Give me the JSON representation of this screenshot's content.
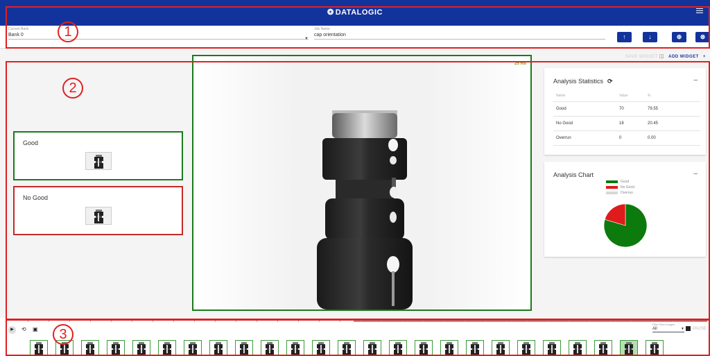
{
  "header": {
    "brand_mark": "❂",
    "brand": "DATALOGIC",
    "menu_icon": "hamburger-icon"
  },
  "job": {
    "bank_label": "Current Bank",
    "bank_value": "Bank 0",
    "job_label": "Job Name",
    "job_value": "cap orientation",
    "buttons": [
      {
        "name": "upload-button",
        "glyph": "↑"
      },
      {
        "name": "download-button",
        "glyph": "↓"
      },
      {
        "name": "add-circle-button",
        "glyph": "⊕"
      },
      {
        "name": "close-circle-button",
        "glyph": "⊗"
      }
    ]
  },
  "widgets": {
    "save": "SAVE WIDGET",
    "add": "ADD WIDGET",
    "save_icon": "save-icon",
    "add_icon": "plus-icon"
  },
  "results": {
    "good": "Good",
    "no_good": "No Good"
  },
  "image": {
    "timing": "25 ms"
  },
  "stats": {
    "title": "Analysis Statistics",
    "refresh_icon": "refresh-icon",
    "minimize": "–",
    "headers": [
      "Name",
      "Value",
      "%"
    ],
    "rows": [
      {
        "name": "Good",
        "value": "70",
        "pct": "79.55"
      },
      {
        "name": "No Good",
        "value": "18",
        "pct": "20.45"
      },
      {
        "name": "Overrun",
        "value": "0",
        "pct": "0.00"
      }
    ]
  },
  "chart": {
    "title": "Analysis Chart",
    "minimize": "–",
    "chart_data": {
      "type": "pie",
      "labels": [
        "Good",
        "No Good",
        "Overrun"
      ],
      "values": [
        70,
        18,
        0
      ],
      "colors": [
        "#0c7a0c",
        "#e01b1b",
        "#d8d8d8"
      ],
      "legend": "top"
    }
  },
  "timeline": {
    "filter_label": "Filter Rew Images",
    "filter_value": "All",
    "pause": "PAUSE",
    "thumb_count": 25,
    "selected_thumb": 23
  },
  "annotations": [
    "1",
    "2",
    "3"
  ]
}
